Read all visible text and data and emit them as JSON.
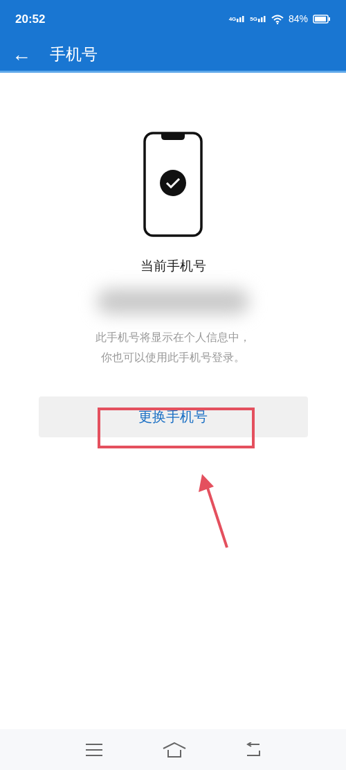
{
  "status_bar": {
    "time": "20:52",
    "network_1": "4G",
    "network_2": "5G",
    "battery": "84%"
  },
  "header": {
    "back": "←",
    "title": "手机号"
  },
  "current": {
    "label": "当前手机号"
  },
  "description": [
    "此手机号将显示在个人信息中，",
    "你也可以使用此手机号登录。"
  ],
  "button": {
    "label": "更换手机号",
    "highlighted": true
  }
}
